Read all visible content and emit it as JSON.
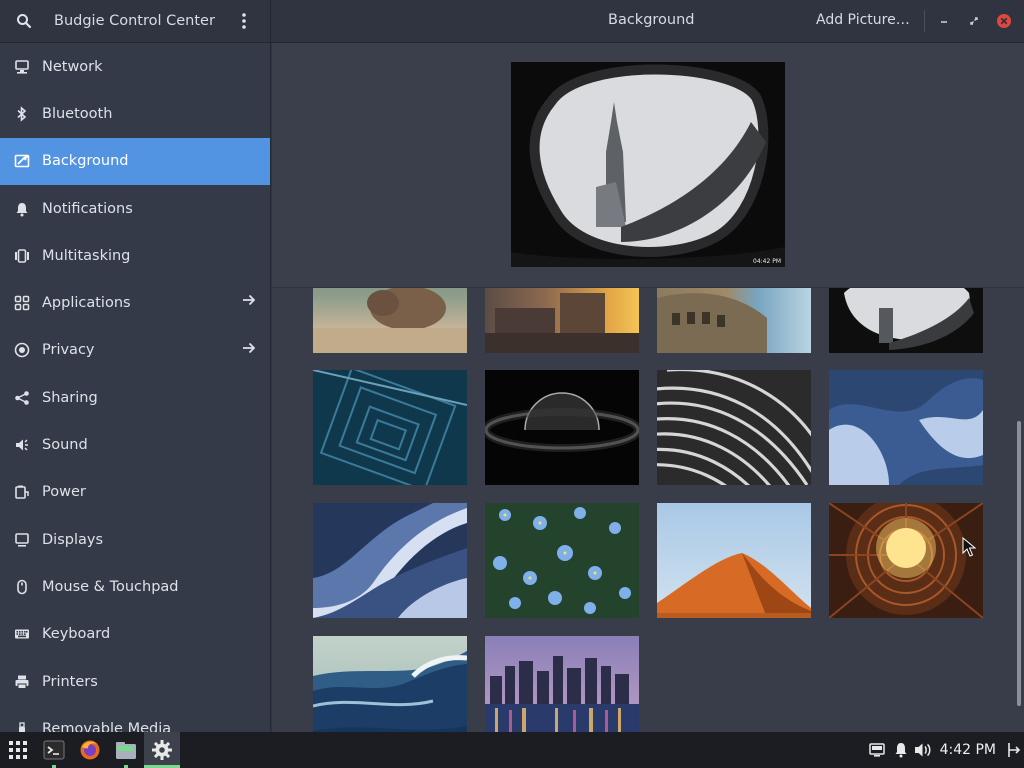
{
  "app": {
    "title": "Budgie Control Center",
    "search_icon": "search-icon",
    "menu_icon": "kebab-menu-icon"
  },
  "header": {
    "title": "Background",
    "add_picture_label": "Add Picture…"
  },
  "window_controls": {
    "minimize": "minimize-icon",
    "restore": "restore-icon",
    "close": "close-icon",
    "close_color": "#e0483e"
  },
  "sidebar": {
    "items": [
      {
        "label": "Network",
        "icon": "network-icon"
      },
      {
        "label": "Bluetooth",
        "icon": "bluetooth-icon"
      },
      {
        "label": "Background",
        "icon": "background-icon",
        "active": true
      },
      {
        "label": "Notifications",
        "icon": "bell-icon"
      },
      {
        "label": "Multitasking",
        "icon": "multitasking-icon"
      },
      {
        "label": "Applications",
        "icon": "grid-icon",
        "arrow": true
      },
      {
        "label": "Privacy",
        "icon": "privacy-icon",
        "arrow": true
      },
      {
        "label": "Sharing",
        "icon": "share-icon"
      },
      {
        "label": "Sound",
        "icon": "speaker-icon"
      },
      {
        "label": "Power",
        "icon": "power-icon"
      },
      {
        "label": "Displays",
        "icon": "display-icon"
      },
      {
        "label": "Mouse & Touchpad",
        "icon": "mouse-icon"
      },
      {
        "label": "Keyboard",
        "icon": "keyboard-icon"
      },
      {
        "label": "Printers",
        "icon": "printer-icon"
      },
      {
        "label": "Removable Media",
        "icon": "usb-icon"
      }
    ]
  },
  "preview": {
    "time": "04:42 PM"
  },
  "wallpapers": [
    "capybara",
    "city-sunset",
    "colosseum",
    "tower-arch",
    "blue-stairs",
    "eclipse-planet",
    "curved-building",
    "blue-abstract-waves",
    "blue-stripes",
    "blue-flowers",
    "orange-dune",
    "round-building-sun",
    "ocean-wave",
    "city-skyline-night"
  ],
  "taskbar": {
    "apps": [
      "app-grid-icon",
      "terminal-icon",
      "firefox-icon",
      "files-icon",
      "settings-icon"
    ],
    "tray": [
      "monitor-icon",
      "notification-bell-icon",
      "volume-icon",
      "power-icon"
    ],
    "clock": "4:42 PM"
  },
  "colors": {
    "accent": "#5294e2",
    "sidebar_bg": "#343a47",
    "content_bg": "#3a3f4b",
    "taskbar_bg": "#1b1d22"
  }
}
